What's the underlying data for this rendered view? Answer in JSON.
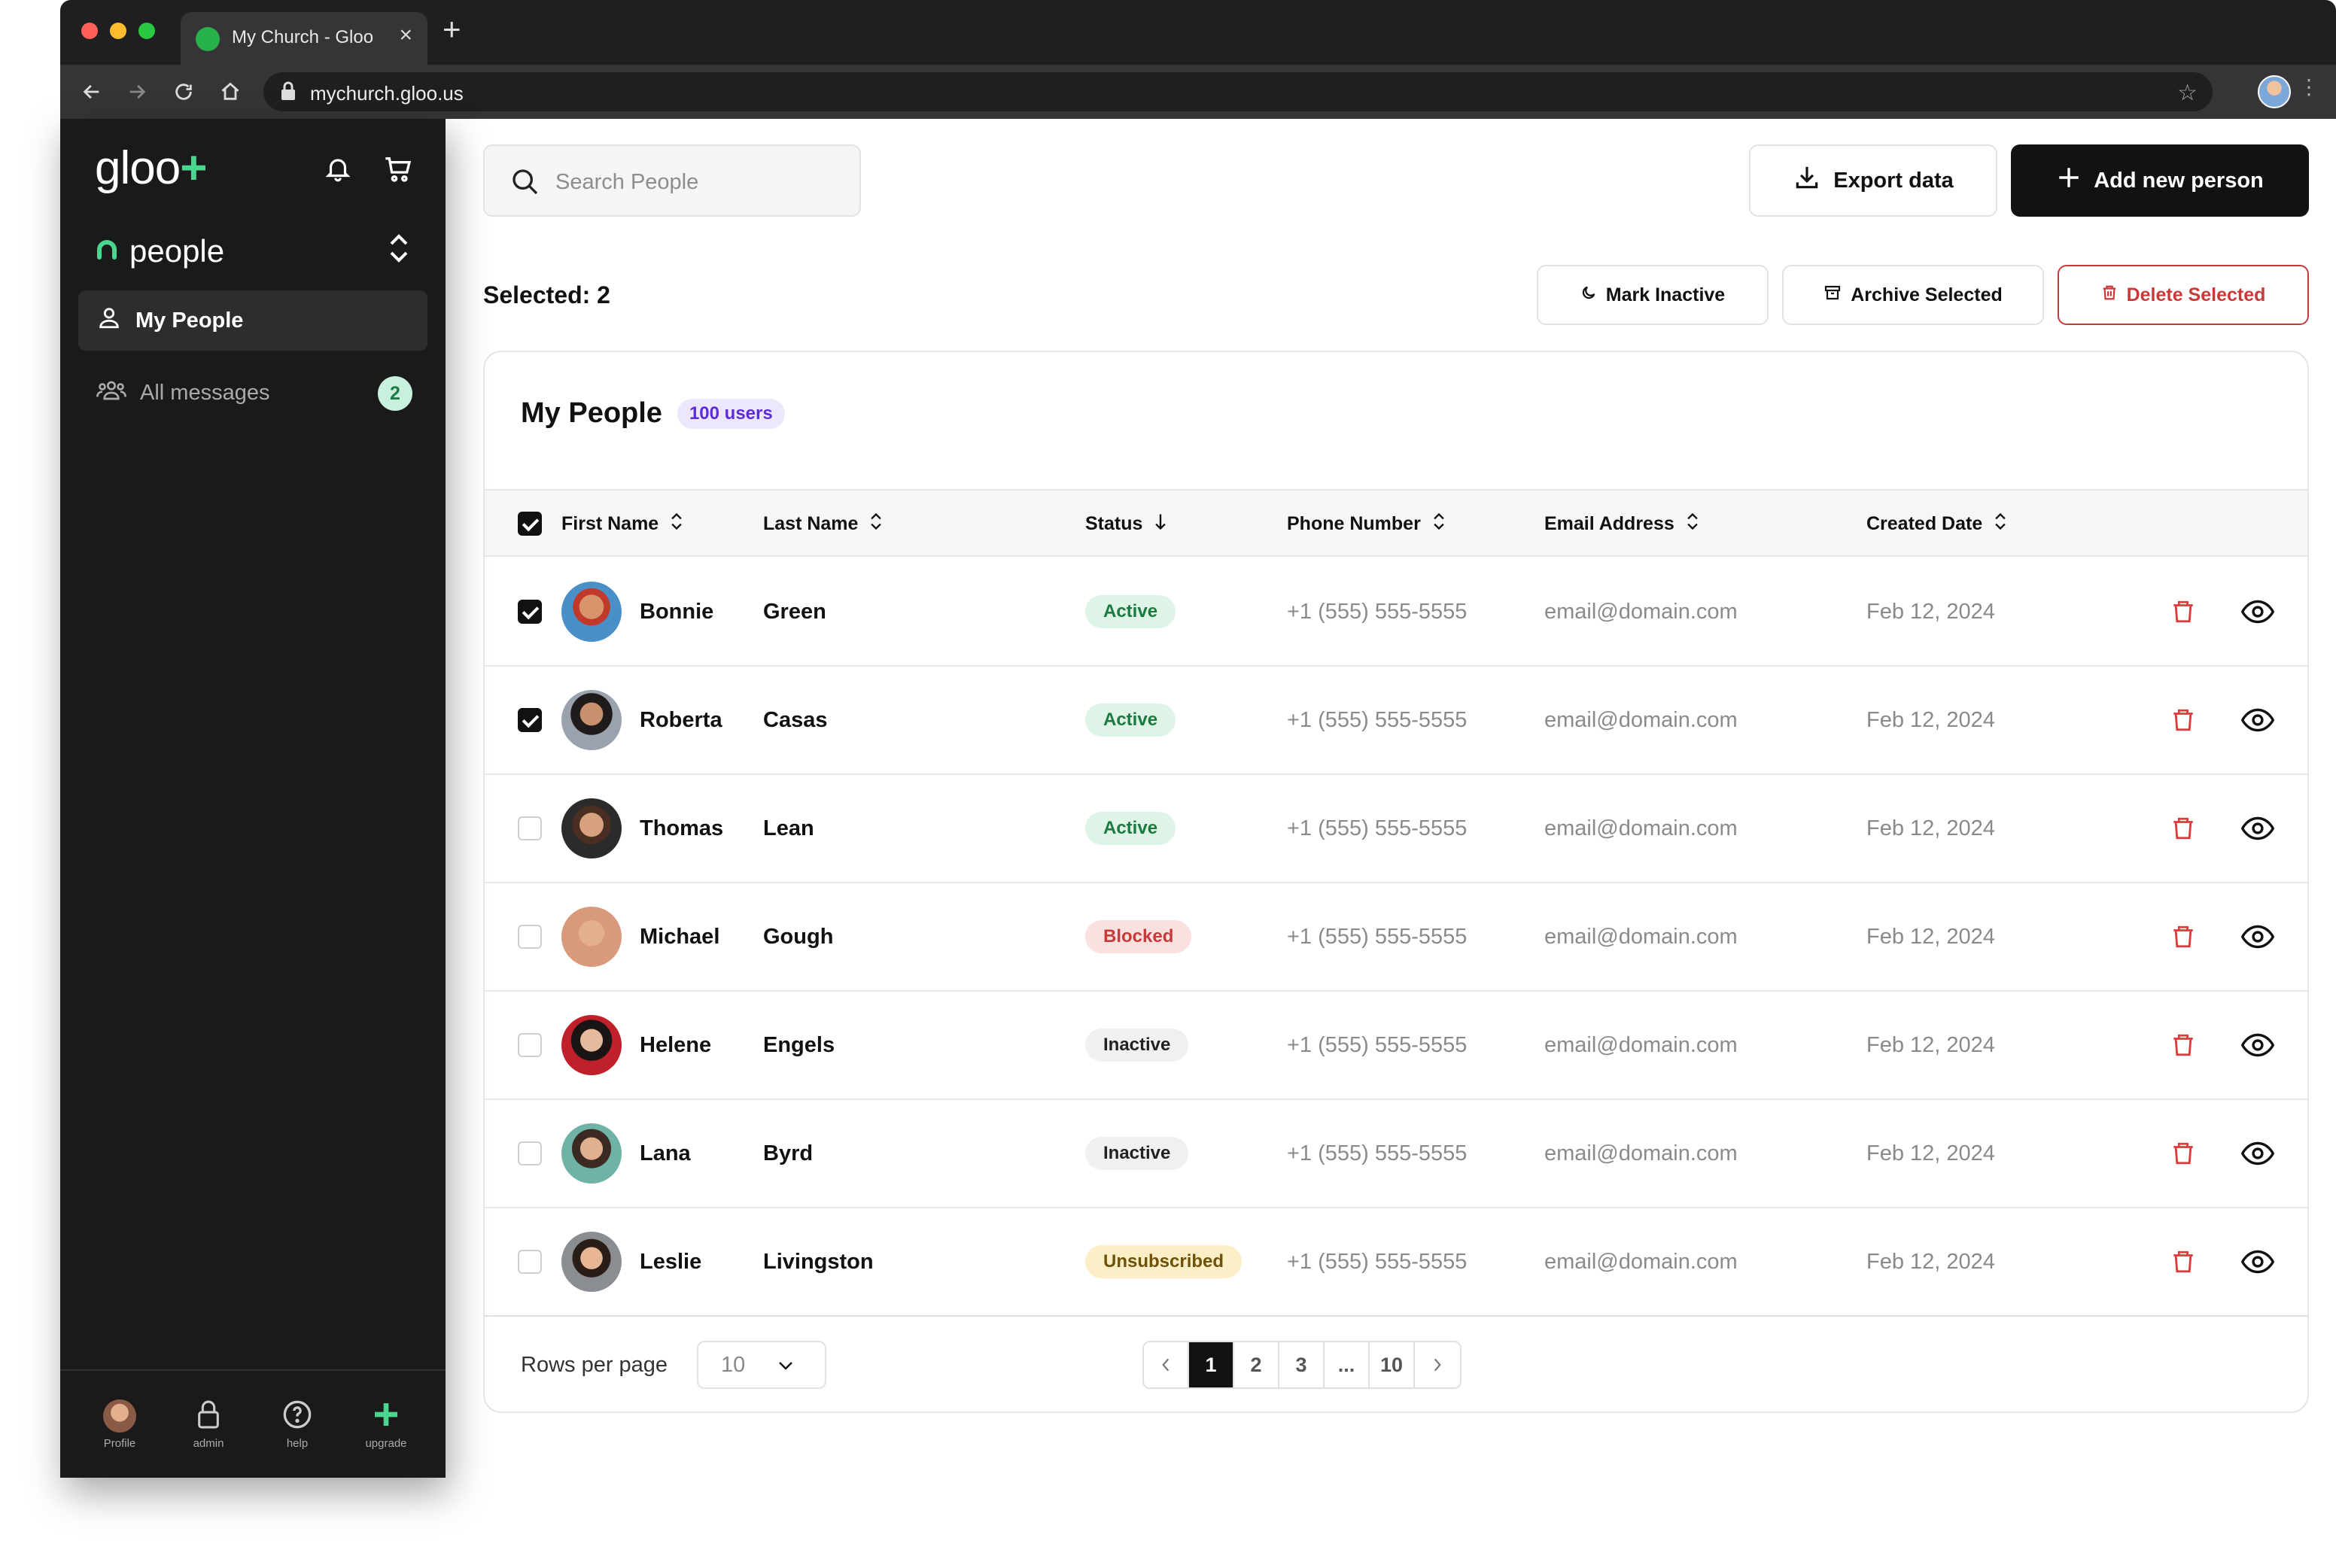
{
  "browser": {
    "tab_title": "My Church - Gloo",
    "url": "mychurch.gloo.us"
  },
  "sidebar": {
    "logo": "gloo",
    "logo_plus": "+",
    "app_name": "people",
    "items": [
      {
        "label": "My People"
      },
      {
        "label": "All messages",
        "badge": "2"
      }
    ],
    "footer": [
      {
        "label": "Profile"
      },
      {
        "label": "admin"
      },
      {
        "label": "help"
      },
      {
        "label": "upgrade"
      }
    ]
  },
  "toolbar": {
    "search_placeholder": "Search People",
    "export_label": "Export data",
    "add_label": "Add new person"
  },
  "selection": {
    "label": "Selected: 2",
    "mark_inactive": "Mark Inactive",
    "archive": "Archive Selected",
    "delete": "Delete Selected"
  },
  "table": {
    "title": "My People",
    "count": "100 users",
    "columns": {
      "first": "First Name",
      "last": "Last Name",
      "status": "Status",
      "phone": "Phone Number",
      "email": "Email Address",
      "created": "Created Date"
    },
    "rows": [
      {
        "first": "Bonnie",
        "last": "Green",
        "status": "Active",
        "phone": "+1 (555) 555-5555",
        "email": "email@domain.com",
        "created": "Feb 12, 2024",
        "checked": true
      },
      {
        "first": "Roberta",
        "last": "Casas",
        "status": "Active",
        "phone": "+1 (555) 555-5555",
        "email": "email@domain.com",
        "created": "Feb 12, 2024",
        "checked": true
      },
      {
        "first": "Thomas",
        "last": "Lean",
        "status": "Active",
        "phone": "+1 (555) 555-5555",
        "email": "email@domain.com",
        "created": "Feb 12, 2024",
        "checked": false
      },
      {
        "first": "Michael",
        "last": "Gough",
        "status": "Blocked",
        "phone": "+1 (555) 555-5555",
        "email": "email@domain.com",
        "created": "Feb 12, 2024",
        "checked": false
      },
      {
        "first": "Helene",
        "last": "Engels",
        "status": "Inactive",
        "phone": "+1 (555) 555-5555",
        "email": "email@domain.com",
        "created": "Feb 12, 2024",
        "checked": false
      },
      {
        "first": "Lana",
        "last": "Byrd",
        "status": "Inactive",
        "phone": "+1 (555) 555-5555",
        "email": "email@domain.com",
        "created": "Feb 12, 2024",
        "checked": false
      },
      {
        "first": "Leslie",
        "last": "Livingston",
        "status": "Unsubscribed",
        "phone": "+1 (555) 555-5555",
        "email": "email@domain.com",
        "created": "Feb 12, 2024",
        "checked": false
      }
    ]
  },
  "pagination": {
    "rows_per_page_label": "Rows per page",
    "rows_per_page": "10",
    "pages": [
      "1",
      "2",
      "3",
      "...",
      "10"
    ],
    "current": "1"
  },
  "colors": {
    "accent_green": "#4bd68f",
    "delete_red": "#c83a3a",
    "primary_dark": "#121212"
  }
}
